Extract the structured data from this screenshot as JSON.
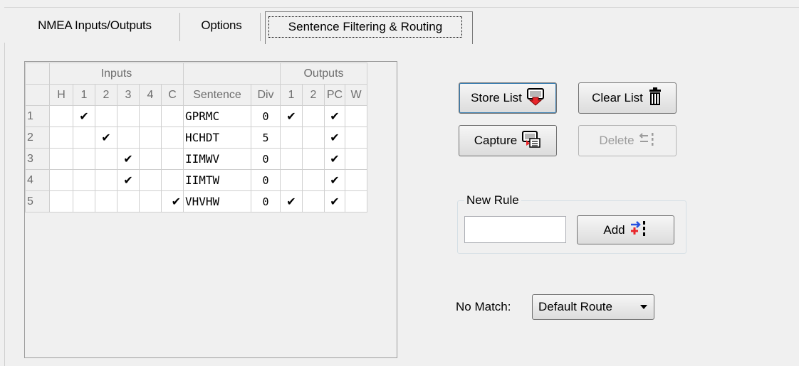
{
  "tabs": [
    {
      "label": "NMEA Inputs/Outputs"
    },
    {
      "label": "Options"
    },
    {
      "label": "Sentence Filtering & Routing"
    }
  ],
  "grid": {
    "group_inputs": "Inputs",
    "group_outputs": "Outputs",
    "columns": [
      "H",
      "1",
      "2",
      "3",
      "4",
      "C",
      "Sentence",
      "Div",
      "1",
      "2",
      "PC",
      "W"
    ],
    "check_glyph": "✔",
    "rows": [
      {
        "num": "1",
        "H": "",
        "i1": "✔",
        "i2": "",
        "i3": "",
        "i4": "",
        "C": "",
        "sentence": "GPRMC",
        "div": "0",
        "o1": "✔",
        "o2": "",
        "pc": "✔",
        "w": ""
      },
      {
        "num": "2",
        "H": "",
        "i1": "",
        "i2": "✔",
        "i3": "",
        "i4": "",
        "C": "",
        "sentence": "HCHDT",
        "div": "5",
        "o1": "",
        "o2": "",
        "pc": "✔",
        "w": ""
      },
      {
        "num": "3",
        "H": "",
        "i1": "",
        "i2": "",
        "i3": "✔",
        "i4": "",
        "C": "",
        "sentence": "IIMWV",
        "div": "0",
        "o1": "",
        "o2": "",
        "pc": "✔",
        "w": ""
      },
      {
        "num": "4",
        "H": "",
        "i1": "",
        "i2": "",
        "i3": "✔",
        "i4": "",
        "C": "",
        "sentence": "IIMTW",
        "div": "0",
        "o1": "",
        "o2": "",
        "pc": "✔",
        "w": ""
      },
      {
        "num": "5",
        "H": "",
        "i1": "",
        "i2": "",
        "i3": "",
        "i4": "",
        "C": "✔",
        "sentence": "VHVHW",
        "div": "0",
        "o1": "✔",
        "o2": "",
        "pc": "✔",
        "w": ""
      }
    ]
  },
  "buttons": {
    "store_list": "Store List",
    "clear_list": "Clear List",
    "capture": "Capture",
    "delete": "Delete",
    "add": "Add"
  },
  "new_rule": {
    "title": "New Rule",
    "value": ""
  },
  "no_match": {
    "label": "No Match:",
    "selected": "Default Route"
  },
  "icons": {
    "store": "store-list-icon",
    "clear": "trash-icon",
    "capture": "capture-icon",
    "delete": "delete-rule-icon",
    "add": "add-rule-icon",
    "dropdown": "chevron-down-icon"
  },
  "colors": {
    "window_bg": "#f0f0f0",
    "grid_bg": "#ffffff",
    "accent_red": "#e8262b",
    "accent_blue": "#2450e0"
  }
}
